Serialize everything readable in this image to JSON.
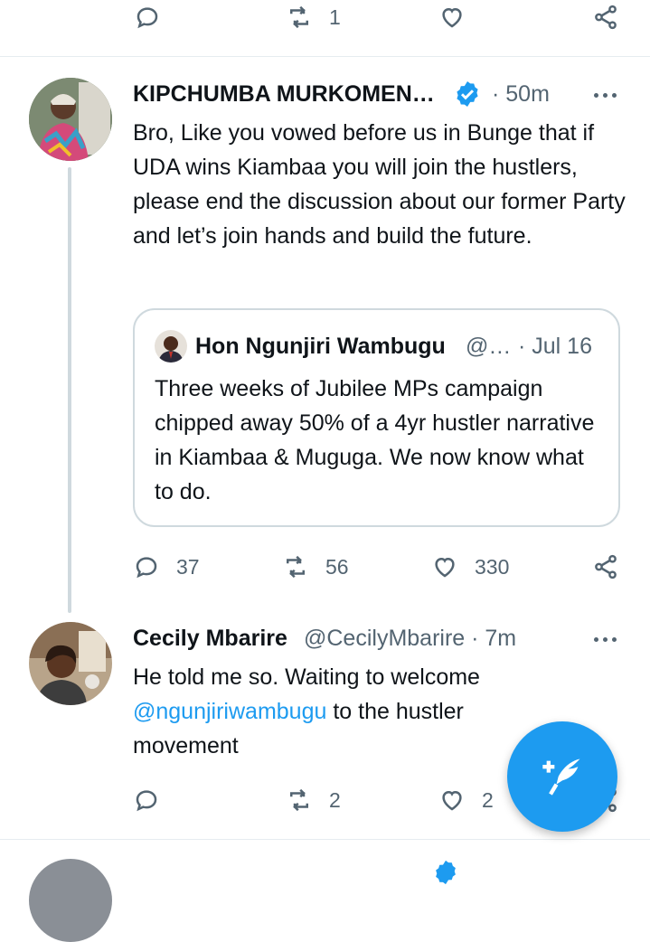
{
  "top_actions": {
    "retweet_count": "1"
  },
  "tweet1": {
    "author_name": "KIPCHUMBA MURKOMEN…",
    "time": "· 50m",
    "text": "Bro, Like you vowed before us in Bunge that if  UDA wins  Kiambaa you will join the hustlers, please end the discussion about our former Party and let’s join hands and build  the future.",
    "quote": {
      "author_name": "Hon Ngunjiri Wambugu",
      "handle": "@…",
      "date": "· Jul 16",
      "text": "Three weeks of Jubilee MPs campaign chipped away 50% of a 4yr hustler narrative in Kiambaa & Muguga. We now know what to do."
    },
    "reply_count": "37",
    "retweet_count": "56",
    "like_count": "330"
  },
  "tweet2": {
    "author_name": "Cecily Mbarire",
    "handle_time": "@CecilyMbarire · 7m",
    "text_line1": "He told me so. Waiting to welcome",
    "mention": "@ngunjiriwambugu",
    "text_line2_rest": " to the hustler",
    "text_line3": "movement",
    "retweet_count": "2",
    "like_count": "2"
  },
  "colors": {
    "accent": "#1d9bf0",
    "muted": "#536471",
    "border": "#cfd9de"
  }
}
